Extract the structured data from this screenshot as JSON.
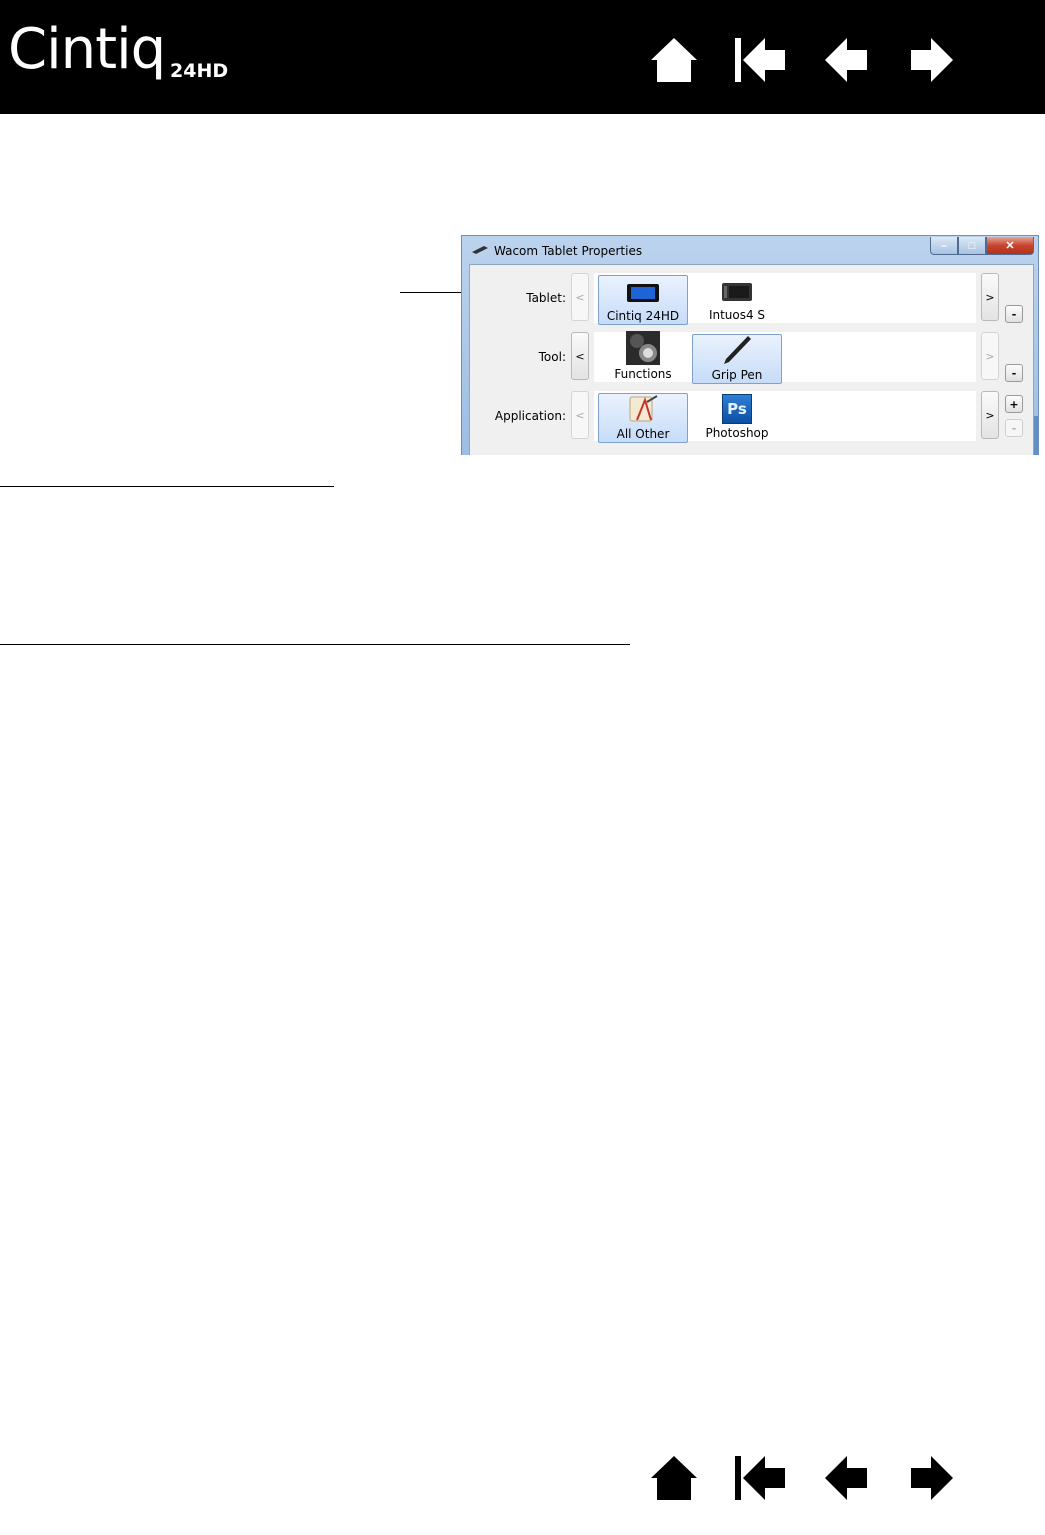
{
  "header": {
    "brand": "Cintiq",
    "model": "24HD",
    "nav": [
      {
        "icon": "home-icon"
      },
      {
        "icon": "first-page-icon"
      },
      {
        "icon": "previous-page-icon"
      },
      {
        "icon": "next-page-icon"
      }
    ]
  },
  "dialog": {
    "title": "Wacom Tablet Properties",
    "window_buttons": {
      "minimize": "–",
      "maximize": "□",
      "close": "✕"
    },
    "rows": [
      {
        "label": "Tablet:",
        "left_arrow": "<",
        "right_arrow": ">",
        "items": [
          {
            "name": "Cintiq 24HD",
            "icon": "cintiq-tablet-icon",
            "selected": true
          },
          {
            "name": "Intuos4 S",
            "icon": "intuos-tablet-icon",
            "selected": false
          }
        ],
        "side_buttons": [
          "-"
        ]
      },
      {
        "label": "Tool:",
        "left_arrow": "<",
        "right_arrow": ">",
        "items": [
          {
            "name": "Functions",
            "icon": "functions-icon",
            "selected": false
          },
          {
            "name": "Grip Pen",
            "icon": "grip-pen-icon",
            "selected": true
          }
        ],
        "side_buttons": [
          "-"
        ]
      },
      {
        "label": "Application:",
        "left_arrow": "<",
        "right_arrow": ">",
        "items": [
          {
            "name": "All Other",
            "icon": "all-other-apps-icon",
            "selected": true
          },
          {
            "name": "Photoshop",
            "icon": "photoshop-icon",
            "selected": false,
            "icon_text": "Ps"
          }
        ],
        "side_buttons": [
          "+",
          "-"
        ]
      }
    ]
  }
}
